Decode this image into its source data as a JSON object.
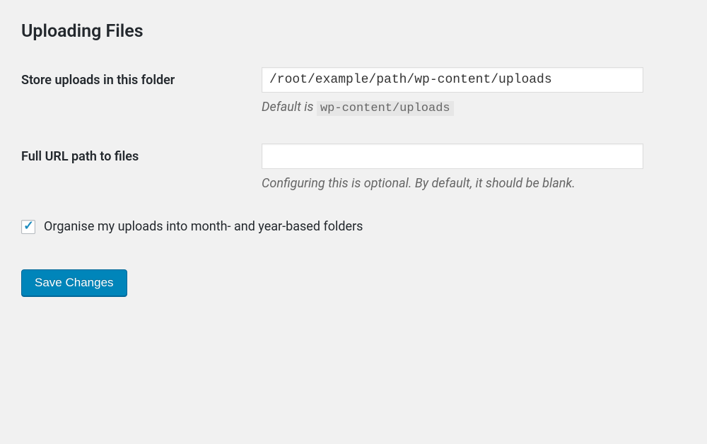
{
  "section": {
    "title": "Uploading Files"
  },
  "fields": {
    "store_uploads": {
      "label": "Store uploads in this folder",
      "value": "/root/example/path/wp-content/uploads",
      "description_prefix": "Default is ",
      "description_code": "wp-content/uploads"
    },
    "full_url": {
      "label": "Full URL path to files",
      "value": "",
      "description": "Configuring this is optional. By default, it should be blank."
    },
    "organise": {
      "label": "Organise my uploads into month- and year-based folders",
      "checked": true
    }
  },
  "actions": {
    "save": "Save Changes"
  }
}
